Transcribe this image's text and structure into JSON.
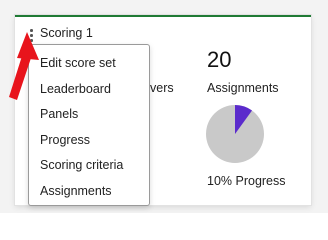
{
  "card": {
    "title": "Scoring 1",
    "left_stat_label_partial": "vers",
    "assignments": {
      "value": "20",
      "label": "Assignments"
    },
    "progress": {
      "percent": 10,
      "label": "10% Progress",
      "fill_color": "#5b2bcc",
      "track_color": "#c9c9c9"
    }
  },
  "menu": {
    "items": [
      {
        "label": "Edit score set"
      },
      {
        "label": "Leaderboard"
      },
      {
        "label": "Panels"
      },
      {
        "label": "Progress"
      },
      {
        "label": "Scoring criteria"
      },
      {
        "label": "Assignments"
      }
    ]
  },
  "annotation": {
    "arrow_color": "#e8141c"
  },
  "colors": {
    "card_accent": "#1f7a34"
  }
}
